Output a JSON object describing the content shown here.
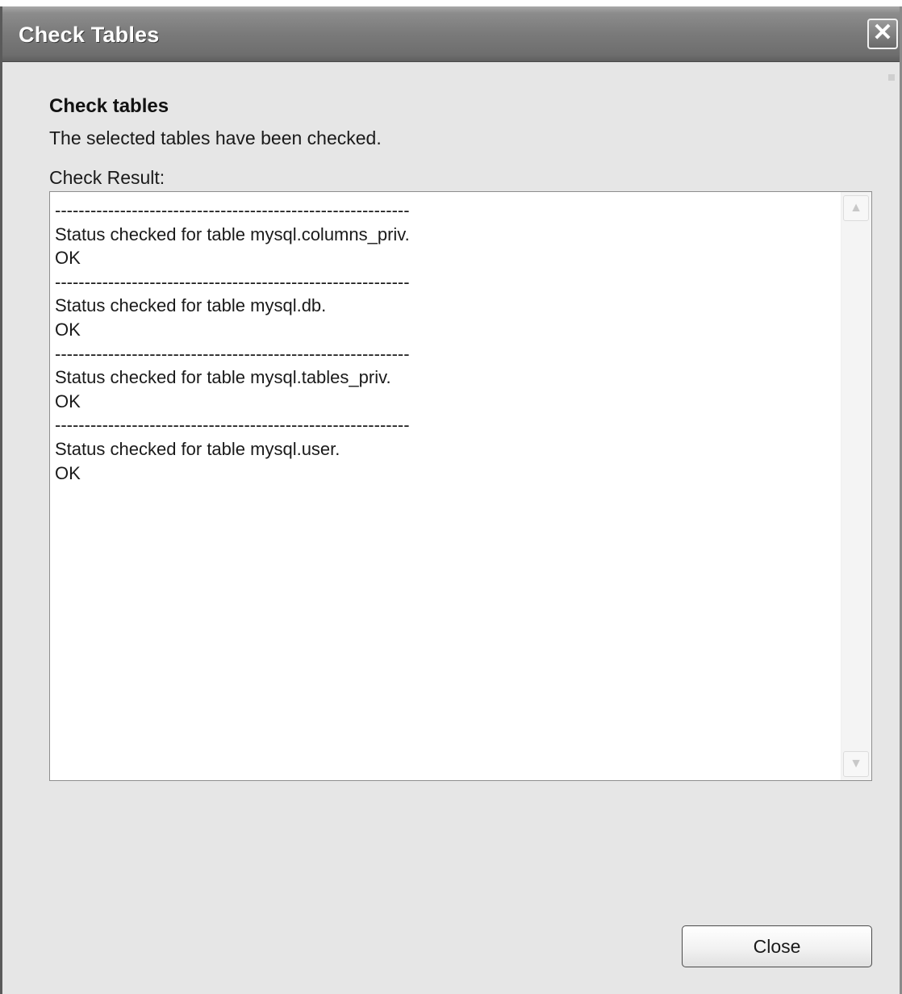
{
  "window": {
    "title": "Check Tables",
    "close_glyph": "✕"
  },
  "content": {
    "heading": "Check tables",
    "description": "The selected tables have been checked.",
    "result_label": "Check Result:",
    "result_lines": [
      "------------------------------------------------------------",
      "Status checked for table mysql.columns_priv.",
      "OK",
      "------------------------------------------------------------",
      "Status checked for table mysql.db.",
      "OK",
      "------------------------------------------------------------",
      "Status checked for table mysql.tables_priv.",
      "OK",
      "------------------------------------------------------------",
      "Status checked for table mysql.user.",
      "OK"
    ]
  },
  "scrollbar": {
    "up_icon": "chevron-up-icon",
    "down_icon": "chevron-down-icon"
  },
  "footer": {
    "close_label": "Close"
  },
  "colors": {
    "titlebar": "#7a7a7a",
    "dialog_background": "#e6e6e6",
    "result_background": "#ffffff"
  }
}
